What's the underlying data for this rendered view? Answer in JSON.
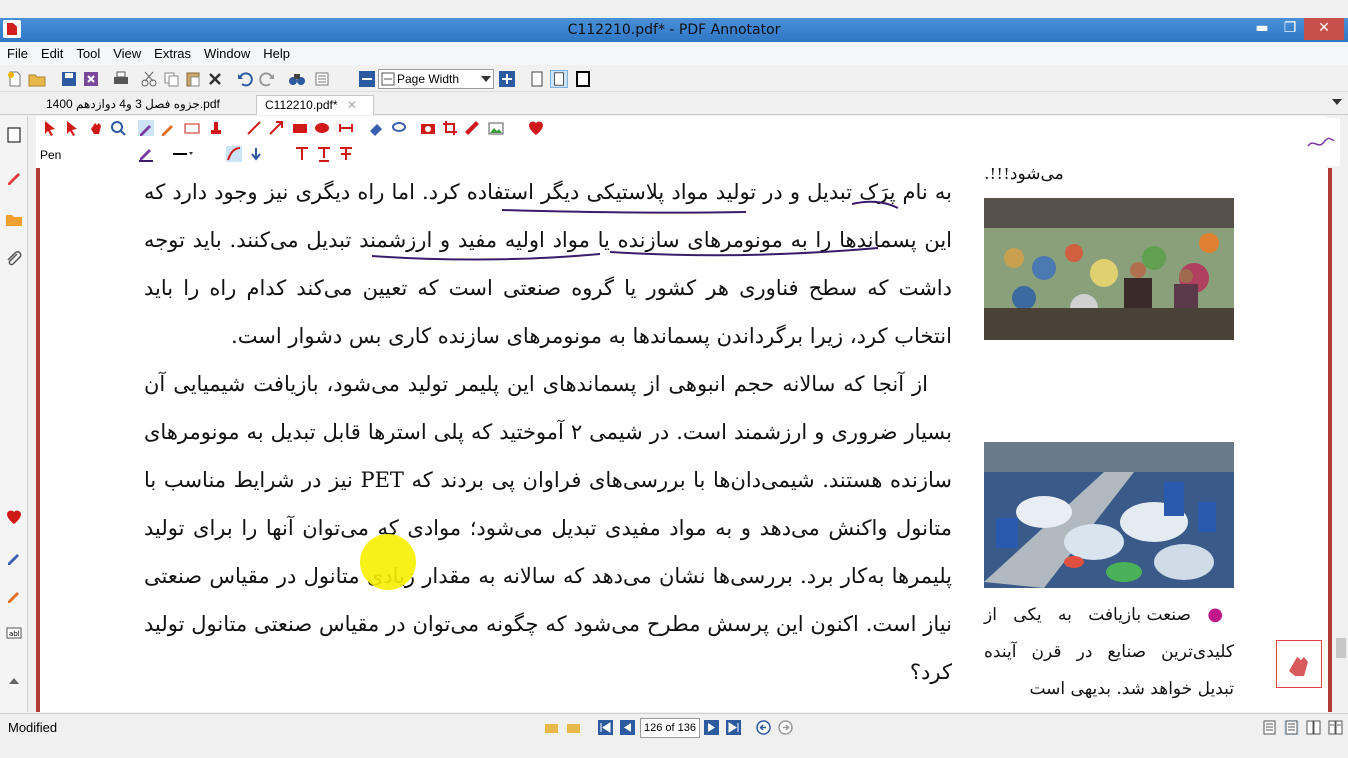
{
  "window": {
    "title": "C112210.pdf* - PDF Annotator",
    "controls": {
      "minimize": "▬",
      "maximize": "❐",
      "close": "✕"
    }
  },
  "menu": [
    "File",
    "Edit",
    "Tool",
    "View",
    "Extras",
    "Window",
    "Help"
  ],
  "toolbar": {
    "zoom_label": "Page Width"
  },
  "tabs": [
    {
      "label": "جزوه فصل 3 و4 دوازدهم 1400.pdf",
      "active": false
    },
    {
      "label": "C112210.pdf*",
      "active": true
    }
  ],
  "annotation_toolbar": {
    "tool_label": "Pen"
  },
  "document": {
    "main_text": [
      "به نام پرَک تبدیل و در تولید مواد پلاستیکی دیگر استفاده کرد. اما راه دیگری نیز وجود دارد که این پسماندها را به مونومرهای سازنده یا مواد اولیه مفید و ارزشمند تبدیل می‌کنند. باید توجه داشت که سطح فناوری هر کشور یا گروه صنعتی است که تعیین می‌کند کدام راه را باید انتخاب کرد، زیرا برگرداندن پسماندها به مونومرهای سازنده کاری بس دشوار است.",
      "از آنجا که سالانه حجم انبوهی از پسماندهای این پلیمر تولید می‌شود، بازیافت شیمیایی آن بسیار ضروری و ارزشمند است. در شیمی ۲ آموختید که پلی استرها قابل تبدیل به مونومرهای سازنده هستند. شیمی‌دان‌ها با بررسی‌های فراوان پی بردند که PET نیز در شرایط مناسب با متانول واکنش می‌دهد و به مواد مفیدی تبدیل می‌شود؛ موادی که می‌توان آنها را برای تولید پلیمرها به‌کار برد. بررسی‌ها نشان می‌دهد که سالانه به مقدار زیادی متانول در مقیاس صنعتی نیاز است. اکنون این پرسش مطرح می‌شود که چگونه می‌توان در مقیاس صنعتی متانول تولید کرد؟"
    ],
    "side_top": "می‌شود!!!.",
    "side_caption": "صنعت بازیافت به یکی از کلیدی‌ترین صنایع در قرن آینده تبدیل خواهد شد. بدیهی است"
  },
  "status": {
    "state": "Modified",
    "page_indicator": "126 of 136"
  },
  "colors": {
    "titlebar": "#3a82cf",
    "page_border": "#b23a34",
    "highlight": "#f7f000",
    "ink": "#3a1c6b"
  }
}
